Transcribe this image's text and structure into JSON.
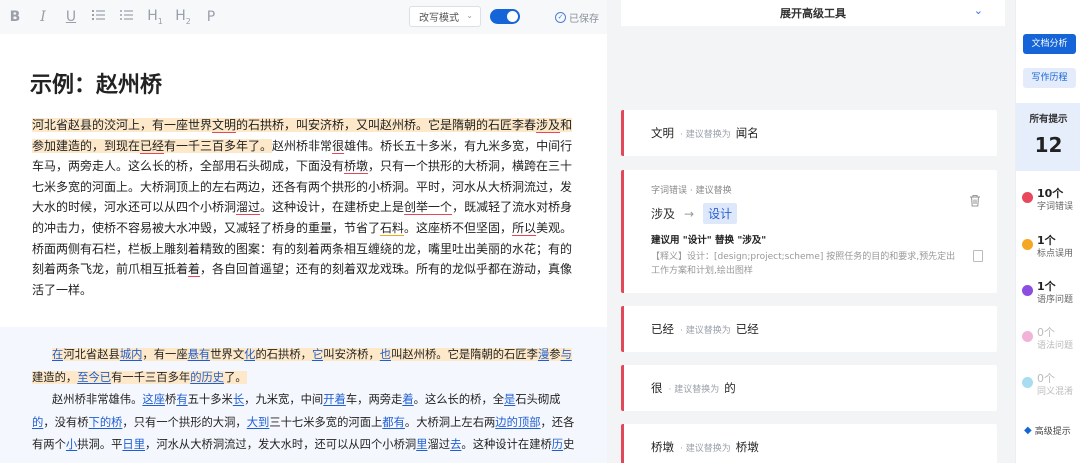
{
  "toolbar": {
    "items": [
      "B",
      "I",
      "U",
      "H",
      "H",
      "P"
    ],
    "mode_select": "改写模式",
    "saved_label": "已保存"
  },
  "doc": {
    "title": "示例：赵州桥",
    "p1_segments": [
      {
        "t": "河北省赵县的洨河上，有一座世界",
        "s": "hl"
      },
      {
        "t": "文明",
        "s": "hl pink"
      },
      {
        "t": "的石拱桥，叫安济桥，又叫赵州桥。它是隋朝的石匠李春",
        "s": "hl"
      },
      {
        "t": "涉及",
        "s": "hl pink"
      },
      {
        "t": "和参加建造的，到现在",
        "s": "hl"
      },
      {
        "t": "已经",
        "s": "hl pink"
      },
      {
        "t": "有一千三百多年了。",
        "s": "hl"
      },
      {
        "t": "赵州桥非常",
        "s": ""
      },
      {
        "t": "很",
        "s": "pink"
      },
      {
        "t": "雄伟。桥长五十多米，有九米多宽，中间行车马，两旁走人。这么长的桥，全部用石头砌成，下面没有",
        "s": ""
      },
      {
        "t": "桥墩",
        "s": "pink"
      },
      {
        "t": "，只有一个拱形的大桥洞，横跨在三十七米多宽的河面上。大桥洞顶上的左右两边，还各有两个拱形的小桥洞。平时，河水从大桥洞流过，发大水的时候，河水还可以从四个小桥洞",
        "s": ""
      },
      {
        "t": "溜过",
        "s": "pink"
      },
      {
        "t": "。这种设计，在建桥史上是",
        "s": ""
      },
      {
        "t": "创举一个",
        "s": "pink"
      },
      {
        "t": "，既减轻了流水对桥身的冲击力，使桥不容易被大水冲毁，又减轻了桥身的重量，节省了",
        "s": ""
      },
      {
        "t": "石料",
        "s": "yel"
      },
      {
        "t": "。",
        "s": ""
      },
      {
        "t": "这座桥不但坚固，",
        "s": ""
      },
      {
        "t": "所以",
        "s": "pink"
      },
      {
        "t": "美观。桥面两侧有石栏，栏板上雕刻着精致的图案：有的刻着两条相互缠绕的龙，嘴里吐出美丽的水花；有的刻着两条飞龙，前爪相互抵着",
        "s": ""
      },
      {
        "t": "着",
        "s": "pink"
      },
      {
        "t": "，各自回首遥望；还有的刻着双龙戏珠。所有的龙似乎都在游动，真像活了一样。",
        "s": ""
      }
    ],
    "p2_segments": [
      {
        "t": "在",
        "s": "hl blu"
      },
      {
        "t": "河北省赵县",
        "s": "hl"
      },
      {
        "t": "城内",
        "s": "hl blu"
      },
      {
        "t": "，有一座",
        "s": "hl"
      },
      {
        "t": "悬有",
        "s": "hl blu"
      },
      {
        "t": "世界文",
        "s": "hl"
      },
      {
        "t": "化",
        "s": "hl blu"
      },
      {
        "t": "的石拱桥，",
        "s": "hl"
      },
      {
        "t": "它",
        "s": "hl blu"
      },
      {
        "t": "叫安济桥，",
        "s": "hl"
      },
      {
        "t": "也",
        "s": "hl blu"
      },
      {
        "t": "叫赵州桥。它是隋朝的石匠李",
        "s": "hl"
      },
      {
        "t": "漫",
        "s": "hl blu"
      },
      {
        "t": "参",
        "s": "hl"
      },
      {
        "t": "与",
        "s": "hl blu"
      },
      {
        "t": "建造的，",
        "s": "hl"
      },
      {
        "t": "至今已",
        "s": "hl blu"
      },
      {
        "t": "有一千三百多年",
        "s": "hl"
      },
      {
        "t": "的历史",
        "s": "hl blu"
      },
      {
        "t": "了。",
        "s": "hl"
      },
      {
        "t": "赵州桥非常雄伟。",
        "s": "nl"
      },
      {
        "t": "这座",
        "s": "blu"
      },
      {
        "t": "桥",
        "s": ""
      },
      {
        "t": "有",
        "s": "blu"
      },
      {
        "t": "五十多米",
        "s": ""
      },
      {
        "t": "长",
        "s": "blu"
      },
      {
        "t": "，九米宽，中间",
        "s": ""
      },
      {
        "t": "开着",
        "s": "blu"
      },
      {
        "t": "车，两旁走",
        "s": ""
      },
      {
        "t": "着",
        "s": "blu"
      },
      {
        "t": "。这么长的桥，全",
        "s": ""
      },
      {
        "t": "是",
        "s": "blu"
      },
      {
        "t": "石头砌成",
        "s": ""
      },
      {
        "t": "的",
        "s": "blu"
      },
      {
        "t": "，没有桥",
        "s": ""
      },
      {
        "t": "下的桥",
        "s": "blu"
      },
      {
        "t": "，只有一个拱形的大洞，",
        "s": ""
      },
      {
        "t": "大到",
        "s": "blu"
      },
      {
        "t": "三十七米多宽的河面上",
        "s": ""
      },
      {
        "t": "都有",
        "s": "blu"
      },
      {
        "t": "。大桥洞上左右两",
        "s": ""
      },
      {
        "t": "边的顶部",
        "s": "blu"
      },
      {
        "t": "，还各有两个",
        "s": ""
      },
      {
        "t": "小",
        "s": "blu"
      },
      {
        "t": "拱洞。平",
        "s": ""
      },
      {
        "t": "日里",
        "s": "blu"
      },
      {
        "t": "，河水从大桥洞流过，发大水时，还可以从四个小桥洞",
        "s": ""
      },
      {
        "t": "里",
        "s": "blu"
      },
      {
        "t": "溜过",
        "s": ""
      },
      {
        "t": "去",
        "s": "blu"
      },
      {
        "t": "。这种设计在建桥",
        "s": ""
      },
      {
        "t": "历",
        "s": "blu"
      },
      {
        "t": "史",
        "s": ""
      }
    ]
  },
  "suggestions": {
    "header": "展开高级工具",
    "hint": "· 建议替换为",
    "cards": [
      {
        "orig": "文明",
        "rep": "闻名"
      },
      {
        "orig": "已经",
        "rep": "已经"
      },
      {
        "orig": "很",
        "rep": "的"
      },
      {
        "orig": "桥墩",
        "rep": "桥墩"
      }
    ],
    "expanded": {
      "tag": "字词错误  · 建议替换",
      "orig": "涉及",
      "rep": "设计",
      "advice": "建议用 \"设计\" 替换 \"涉及\"",
      "definition": "【释义】设计：[design;project;scheme] 按照任务的目的和要求,预先定出工作方案和计划,绘出图样"
    }
  },
  "rail": {
    "analyze": "文档分析",
    "history": "写作历程",
    "all_label": "所有提示",
    "all_count": "12",
    "stats": [
      {
        "count": "10个",
        "label": "字词错误",
        "color": "#e8475c"
      },
      {
        "count": "1个",
        "label": "标点误用",
        "color": "#f5a623"
      },
      {
        "count": "1个",
        "label": "语序问题",
        "color": "#8a4fe0"
      },
      {
        "count": "0个",
        "label": "语法问题",
        "color": "#f2b3d8"
      },
      {
        "count": "0个",
        "label": "同义混淆",
        "color": "#a8dcf0"
      }
    ],
    "advanced": "高级提示"
  }
}
